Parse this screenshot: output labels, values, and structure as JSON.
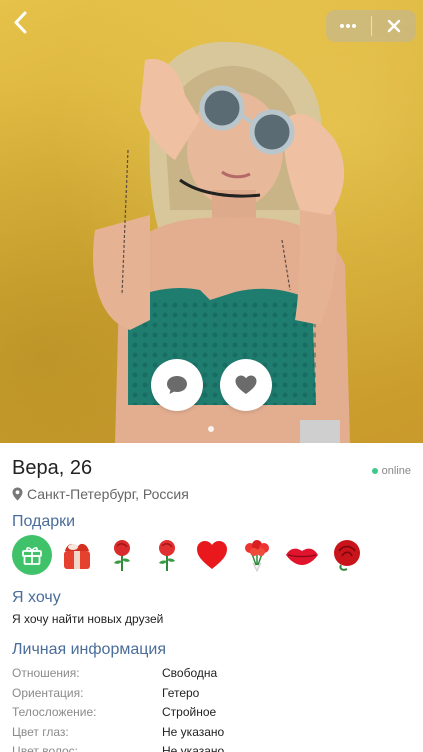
{
  "header": {
    "back_icon": "chevron-left-icon",
    "more_icon": "more-dots-icon",
    "close_icon": "close-icon",
    "actions": [
      {
        "icon": "chat-bubble-icon"
      },
      {
        "icon": "heart-icon"
      }
    ],
    "photo_count_indicator": 1
  },
  "profile": {
    "name_age": "Вера, 26",
    "status": "online",
    "status_color": "#3ec98a",
    "location": "Санкт-Петербург, Россия"
  },
  "gifts": {
    "title": "Подарки",
    "items": [
      {
        "icon": "gift-add-icon"
      },
      {
        "icon": "gift-box-icon"
      },
      {
        "icon": "rose-icon"
      },
      {
        "icon": "rose-icon"
      },
      {
        "icon": "heart-icon"
      },
      {
        "icon": "flowers-icon"
      },
      {
        "icon": "lips-icon"
      },
      {
        "icon": "rose-bud-icon"
      }
    ]
  },
  "want": {
    "title": "Я хочу",
    "text": "Я хочу найти новых друзей"
  },
  "personal": {
    "title": "Личная информация",
    "rows": [
      {
        "label": "Отношения:",
        "value": "Свободна"
      },
      {
        "label": "Ориентация:",
        "value": "Гетеро"
      },
      {
        "label": "Телосложение:",
        "value": "Стройное"
      },
      {
        "label": "Цвет глаз:",
        "value": "Не указано"
      },
      {
        "label": "Цвет волос:",
        "value": "Не указано"
      }
    ]
  },
  "colors": {
    "accent": "#4a6d9a",
    "gift_add": "#3fc26a"
  }
}
